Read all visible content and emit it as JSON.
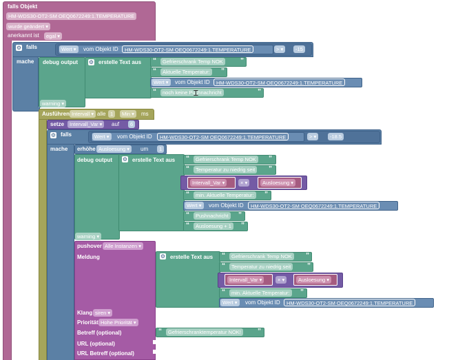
{
  "trigger": {
    "title": "falls Objekt",
    "object_id": "HM-WDS30-OT2-SM OEQ0672249:1.TEMPERATURE",
    "mode": "wurde geändert",
    "ack_label": "anerkannt ist",
    "ack_value": "egal"
  },
  "if1": {
    "falls": "falls",
    "wert": "Wert",
    "vom": "vom Objekt ID",
    "object_id": "HM-WDS30-OT2-SM OEQ0672249:1.TEMPERATURE",
    "op": ">",
    "value": "-15",
    "mache": "mache",
    "debug": "debug output",
    "text_join": "erstelle Text aus",
    "texts": [
      "Gefrierschrank Temp NOK",
      "Aktuelle Temperatur:"
    ],
    "wert2": "Wert",
    "vom2": "vom Objekt ID",
    "object_id2": "HM-WDS30-OT2-SM OEQ0672249:1.TEMPERATURE",
    "text_last": "noch keine Pushnachricht",
    "level": "warning"
  },
  "interval": {
    "run": "Ausführen",
    "kind": "Intervall",
    "every": "alle",
    "num": "1",
    "unit": "Min",
    "ms": "ms"
  },
  "setvar": {
    "label": "setze",
    "var": "Intervall_Var",
    "to": "auf",
    "value": "6"
  },
  "if2": {
    "falls": "falls",
    "wert": "Wert",
    "vom": "vom Objekt ID",
    "object_id": "HM-WDS30-OT2-SM OEQ0672249:1.TEMPERATURE",
    "op": ">",
    "value": "-18.5",
    "mache": "mache",
    "inc": "erhöhe",
    "inc_var": "Ausloesung",
    "inc_by": "um",
    "inc_val": "1",
    "debug": "debug output",
    "text_join": "erstelle Text aus",
    "t1": "Gefrierschrank Temp NOK",
    "t2": "Temperatur zu niedrig seit",
    "mul_a": "Intervall_Var",
    "mul_op": "×",
    "mul_b": "Ausloesung",
    "t3": "min. Aktuelle Temperatur:",
    "vom2": "vom Objekt ID",
    "object_id2": "HM-WDS30-OT2-SM OEQ0672249:1.TEMPERATURE",
    "t4": "Pushnachricht",
    "t5": "Ausloesung + 1",
    "level": "warning"
  },
  "pushover": {
    "label": "pushover",
    "instances": "Alle Instanzen",
    "meldung": "Meldung",
    "text_join": "erstelle Text aus",
    "t1": "Gefrierschrank Temp NOK",
    "t2": "Temperatur zu niedrig seit",
    "mul_a": "Intervall_Var",
    "mul_op": "×",
    "mul_b": "Ausloesung",
    "t3": "min. Aktuelle Temperatur:",
    "wert": "Wert",
    "vom": "vom Objekt ID",
    "object_id": "HM-WDS30-OT2-SM OEQ0672249:1.TEMPERATURE",
    "klang": "Klang",
    "klang_val": "siren",
    "prio": "Priorität",
    "prio_val": "Hohe Priorität",
    "betreff": "Betreff (optional)",
    "betreff_val": "Gefrierschranktemperatur NOK!",
    "url": "URL (optional)",
    "url_betreff": "URL Betreff (optional)"
  },
  "colors": {
    "trigger": "#b06895",
    "logic": "#5b80a5",
    "text": "#5ba58c",
    "timer": "#a5a55b",
    "variable": "#745ba5",
    "pushover": "#a55ba5"
  }
}
